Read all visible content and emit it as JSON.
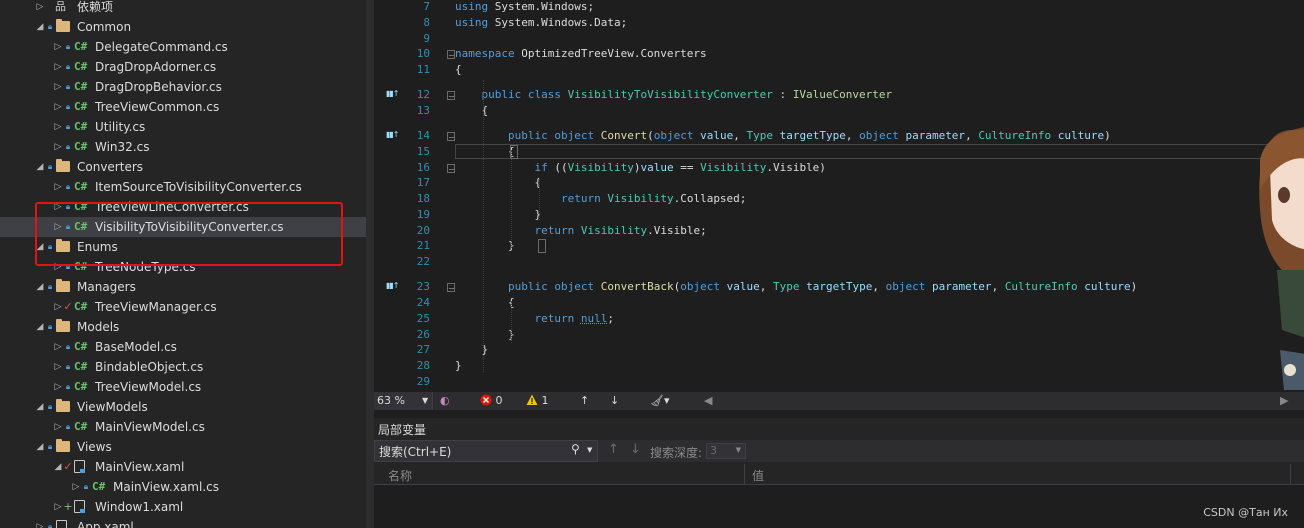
{
  "explorer": {
    "items": [
      {
        "label": "依赖项",
        "kind": "deps",
        "indent": 1,
        "twisty": "▷",
        "lock": false
      },
      {
        "label": "Common",
        "kind": "folder",
        "indent": 1,
        "twisty": "◢",
        "lock": true
      },
      {
        "label": "DelegateCommand.cs",
        "kind": "cs",
        "indent": 2,
        "twisty": "▷",
        "lock": true
      },
      {
        "label": "DragDropAdorner.cs",
        "kind": "cs",
        "indent": 2,
        "twisty": "▷",
        "lock": true
      },
      {
        "label": "DragDropBehavior.cs",
        "kind": "cs",
        "indent": 2,
        "twisty": "▷",
        "lock": true
      },
      {
        "label": "TreeViewCommon.cs",
        "kind": "cs",
        "indent": 2,
        "twisty": "▷",
        "lock": true
      },
      {
        "label": "Utility.cs",
        "kind": "cs",
        "indent": 2,
        "twisty": "▷",
        "lock": true
      },
      {
        "label": "Win32.cs",
        "kind": "cs",
        "indent": 2,
        "twisty": "▷",
        "lock": true
      },
      {
        "label": "Converters",
        "kind": "folder",
        "indent": 1,
        "twisty": "◢",
        "lock": true
      },
      {
        "label": "ItemSourceToVisibilityConverter.cs",
        "kind": "cs",
        "indent": 2,
        "twisty": "▷",
        "lock": true
      },
      {
        "label": "TreeViewLineConverter.cs",
        "kind": "cs",
        "indent": 2,
        "twisty": "▷",
        "lock": true
      },
      {
        "label": "VisibilityToVisibilityConverter.cs",
        "kind": "cs",
        "indent": 2,
        "twisty": "▷",
        "lock": true,
        "selected": true
      },
      {
        "label": "Enums",
        "kind": "folder",
        "indent": 1,
        "twisty": "◢",
        "lock": true
      },
      {
        "label": "TreeNodeType.cs",
        "kind": "cs",
        "indent": 2,
        "twisty": "▷",
        "lock": true
      },
      {
        "label": "Managers",
        "kind": "folder",
        "indent": 1,
        "twisty": "◢",
        "lock": true
      },
      {
        "label": "TreeViewManager.cs",
        "kind": "cs",
        "indent": 2,
        "twisty": "▷",
        "lock": false,
        "check": true
      },
      {
        "label": "Models",
        "kind": "folder",
        "indent": 1,
        "twisty": "◢",
        "lock": true
      },
      {
        "label": "BaseModel.cs",
        "kind": "cs",
        "indent": 2,
        "twisty": "▷",
        "lock": true
      },
      {
        "label": "BindableObject.cs",
        "kind": "cs",
        "indent": 2,
        "twisty": "▷",
        "lock": true
      },
      {
        "label": "TreeViewModel.cs",
        "kind": "cs",
        "indent": 2,
        "twisty": "▷",
        "lock": true
      },
      {
        "label": "ViewModels",
        "kind": "folder",
        "indent": 1,
        "twisty": "◢",
        "lock": true
      },
      {
        "label": "MainViewModel.cs",
        "kind": "cs",
        "indent": 2,
        "twisty": "▷",
        "lock": true
      },
      {
        "label": "Views",
        "kind": "folder",
        "indent": 1,
        "twisty": "◢",
        "lock": true
      },
      {
        "label": "MainView.xaml",
        "kind": "xaml",
        "indent": 2,
        "twisty": "◢",
        "lock": false,
        "check": true
      },
      {
        "label": "MainView.xaml.cs",
        "kind": "cs",
        "indent": 3,
        "twisty": "▷",
        "lock": true
      },
      {
        "label": "Window1.xaml",
        "kind": "xaml",
        "indent": 2,
        "twisty": "▷",
        "lock": false,
        "plus": true
      },
      {
        "label": "App.xaml",
        "kind": "xaml",
        "indent": 1,
        "twisty": "▷",
        "lock": true
      }
    ]
  },
  "editor": {
    "lines": [
      {
        "n": "7",
        "tokens": [
          [
            "kw",
            "using"
          ],
          [
            "plain",
            " System.Windows;"
          ]
        ]
      },
      {
        "n": "8",
        "tokens": [
          [
            "kw",
            "using"
          ],
          [
            "plain",
            " System.Windows.Data;"
          ]
        ]
      },
      {
        "n": "9",
        "tokens": []
      },
      {
        "n": "10",
        "tokens": [
          [
            "kw",
            "namespace"
          ],
          [
            "plain",
            " OptimizedTreeView.Converters"
          ]
        ]
      },
      {
        "n": "11",
        "tokens": [
          [
            "plain",
            "{"
          ]
        ]
      },
      {
        "n": "12",
        "tokens": [
          [
            "plain",
            "    "
          ],
          [
            "kw",
            "public"
          ],
          [
            "plain",
            " "
          ],
          [
            "kw",
            "class"
          ],
          [
            "plain",
            " "
          ],
          [
            "ty",
            "VisibilityToVisibilityConverter"
          ],
          [
            "plain",
            " : "
          ],
          [
            "if",
            "IValueConverter"
          ]
        ]
      },
      {
        "n": "13",
        "tokens": [
          [
            "plain",
            "    {"
          ]
        ]
      },
      {
        "n": "14",
        "tokens": [
          [
            "plain",
            "        "
          ],
          [
            "kw",
            "public"
          ],
          [
            "plain",
            " "
          ],
          [
            "kw",
            "object"
          ],
          [
            "plain",
            " "
          ],
          [
            "mt",
            "Convert"
          ],
          [
            "plain",
            "("
          ],
          [
            "kw",
            "object"
          ],
          [
            "plain",
            " "
          ],
          [
            "pr",
            "value"
          ],
          [
            "plain",
            ", "
          ],
          [
            "ty",
            "Type"
          ],
          [
            "plain",
            " "
          ],
          [
            "pr",
            "targetType"
          ],
          [
            "plain",
            ", "
          ],
          [
            "kw",
            "object"
          ],
          [
            "plain",
            " "
          ],
          [
            "pr",
            "parameter"
          ],
          [
            "plain",
            ", "
          ],
          [
            "ty",
            "CultureInfo"
          ],
          [
            "plain",
            " "
          ],
          [
            "pr",
            "culture"
          ],
          [
            "plain",
            ")"
          ]
        ]
      },
      {
        "n": "15",
        "tokens": [
          [
            "plain",
            "        {"
          ]
        ]
      },
      {
        "n": "16",
        "tokens": [
          [
            "plain",
            "            "
          ],
          [
            "kw",
            "if"
          ],
          [
            "plain",
            " (("
          ],
          [
            "ty",
            "Visibility"
          ],
          [
            "plain",
            ")"
          ],
          [
            "pr",
            "value"
          ],
          [
            "plain",
            " == "
          ],
          [
            "ty",
            "Visibility"
          ],
          [
            "plain",
            ".Visible)"
          ]
        ]
      },
      {
        "n": "17",
        "tokens": [
          [
            "plain",
            "            {"
          ]
        ]
      },
      {
        "n": "18",
        "tokens": [
          [
            "plain",
            "                "
          ],
          [
            "kw",
            "return"
          ],
          [
            "plain",
            " "
          ],
          [
            "ty",
            "Visibility"
          ],
          [
            "plain",
            ".Collapsed;"
          ]
        ]
      },
      {
        "n": "19",
        "tokens": [
          [
            "plain",
            "            }"
          ]
        ]
      },
      {
        "n": "20",
        "tokens": [
          [
            "plain",
            "            "
          ],
          [
            "kw",
            "return"
          ],
          [
            "plain",
            " "
          ],
          [
            "ty",
            "Visibility"
          ],
          [
            "plain",
            ".Visible;"
          ]
        ]
      },
      {
        "n": "21",
        "tokens": [
          [
            "plain",
            "        }"
          ]
        ]
      },
      {
        "n": "22",
        "tokens": []
      },
      {
        "n": "23",
        "tokens": [
          [
            "plain",
            "        "
          ],
          [
            "kw",
            "public"
          ],
          [
            "plain",
            " "
          ],
          [
            "kw",
            "object"
          ],
          [
            "plain",
            " "
          ],
          [
            "mt",
            "ConvertBack"
          ],
          [
            "plain",
            "("
          ],
          [
            "kw",
            "object"
          ],
          [
            "plain",
            " "
          ],
          [
            "pr",
            "value"
          ],
          [
            "plain",
            ", "
          ],
          [
            "ty",
            "Type"
          ],
          [
            "plain",
            " "
          ],
          [
            "pr",
            "targetType"
          ],
          [
            "plain",
            ", "
          ],
          [
            "kw",
            "object"
          ],
          [
            "plain",
            " "
          ],
          [
            "pr",
            "parameter"
          ],
          [
            "plain",
            ", "
          ],
          [
            "ty",
            "CultureInfo"
          ],
          [
            "plain",
            " "
          ],
          [
            "pr",
            "culture"
          ],
          [
            "plain",
            ")"
          ]
        ]
      },
      {
        "n": "24",
        "tokens": [
          [
            "plain",
            "        {"
          ]
        ]
      },
      {
        "n": "25",
        "tokens": [
          [
            "plain",
            "            "
          ],
          [
            "kw",
            "return"
          ],
          [
            "plain",
            " "
          ],
          [
            "kw",
            "null"
          ],
          [
            "plain",
            ";"
          ]
        ]
      },
      {
        "n": "26",
        "tokens": [
          [
            "plain",
            "        }"
          ]
        ]
      },
      {
        "n": "27",
        "tokens": [
          [
            "plain",
            "    }"
          ]
        ]
      },
      {
        "n": "28",
        "tokens": [
          [
            "plain",
            "}"
          ]
        ]
      },
      {
        "n": "29",
        "tokens": []
      }
    ]
  },
  "status": {
    "zoom": "63 %",
    "errors": "0",
    "warnings": "1"
  },
  "locals": {
    "title": "局部变量",
    "search_placeholder": "搜索(Ctrl+E)",
    "depth_label": "搜索深度:",
    "depth_value": "3",
    "col_name": "名称",
    "col_value": "值"
  },
  "watermark": "CSDN @Тан Их",
  "colors": {
    "keyword": "#569cd6",
    "type": "#4ec9b0",
    "interface": "#b8d7a3",
    "method": "#dcdcaa",
    "param": "#9cdcfe",
    "line_number": "#2b91af",
    "highlight_box": "#e01414"
  }
}
